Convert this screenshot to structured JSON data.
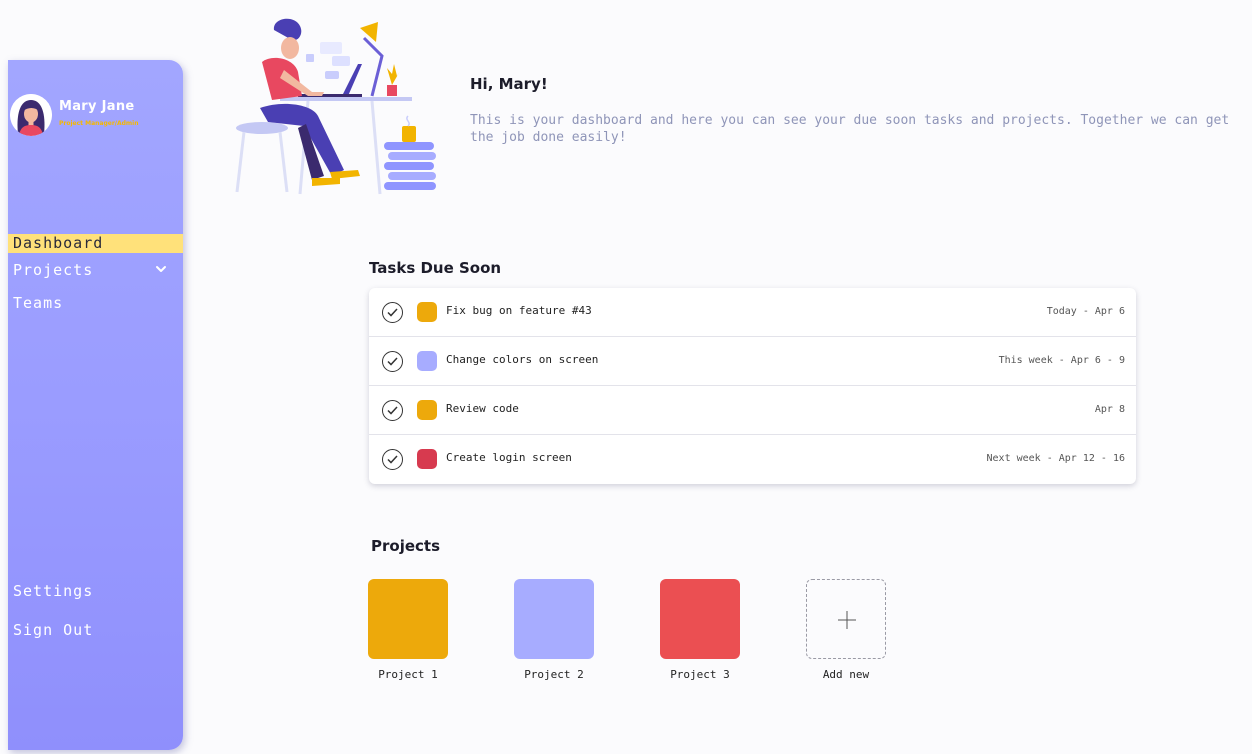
{
  "user": {
    "name": "Mary Jane",
    "role": "Project Manager/Admin"
  },
  "nav": {
    "dashboard": "Dashboard",
    "projects": "Projects",
    "teams": "Teams",
    "settings": "Settings",
    "sign_out": "Sign Out"
  },
  "hero": {
    "greeting": "Hi, Mary!",
    "intro": "This is your dashboard and here you can see your due soon tasks and projects. Together we can get the job done easily!"
  },
  "tasks": {
    "title": "Tasks Due Soon",
    "items": [
      {
        "name": "Fix bug on feature #43",
        "due": "Today - Apr 6",
        "color": "#eda90b"
      },
      {
        "name": "Change colors on screen",
        "due": "This week - Apr 6 - 9",
        "color": "#a7acff"
      },
      {
        "name": "Review code",
        "due": "Apr 8",
        "color": "#eda90b"
      },
      {
        "name": "Create login screen",
        "due": "Next week - Apr 12 - 16",
        "color": "#d73a4f"
      }
    ]
  },
  "projects": {
    "title": "Projects",
    "items": [
      {
        "label": "Project 1",
        "color": "#eda90b"
      },
      {
        "label": "Project 2",
        "color": "#a7acff"
      },
      {
        "label": "Project 3",
        "color": "#eb4f52"
      }
    ],
    "add_label": "Add new"
  }
}
